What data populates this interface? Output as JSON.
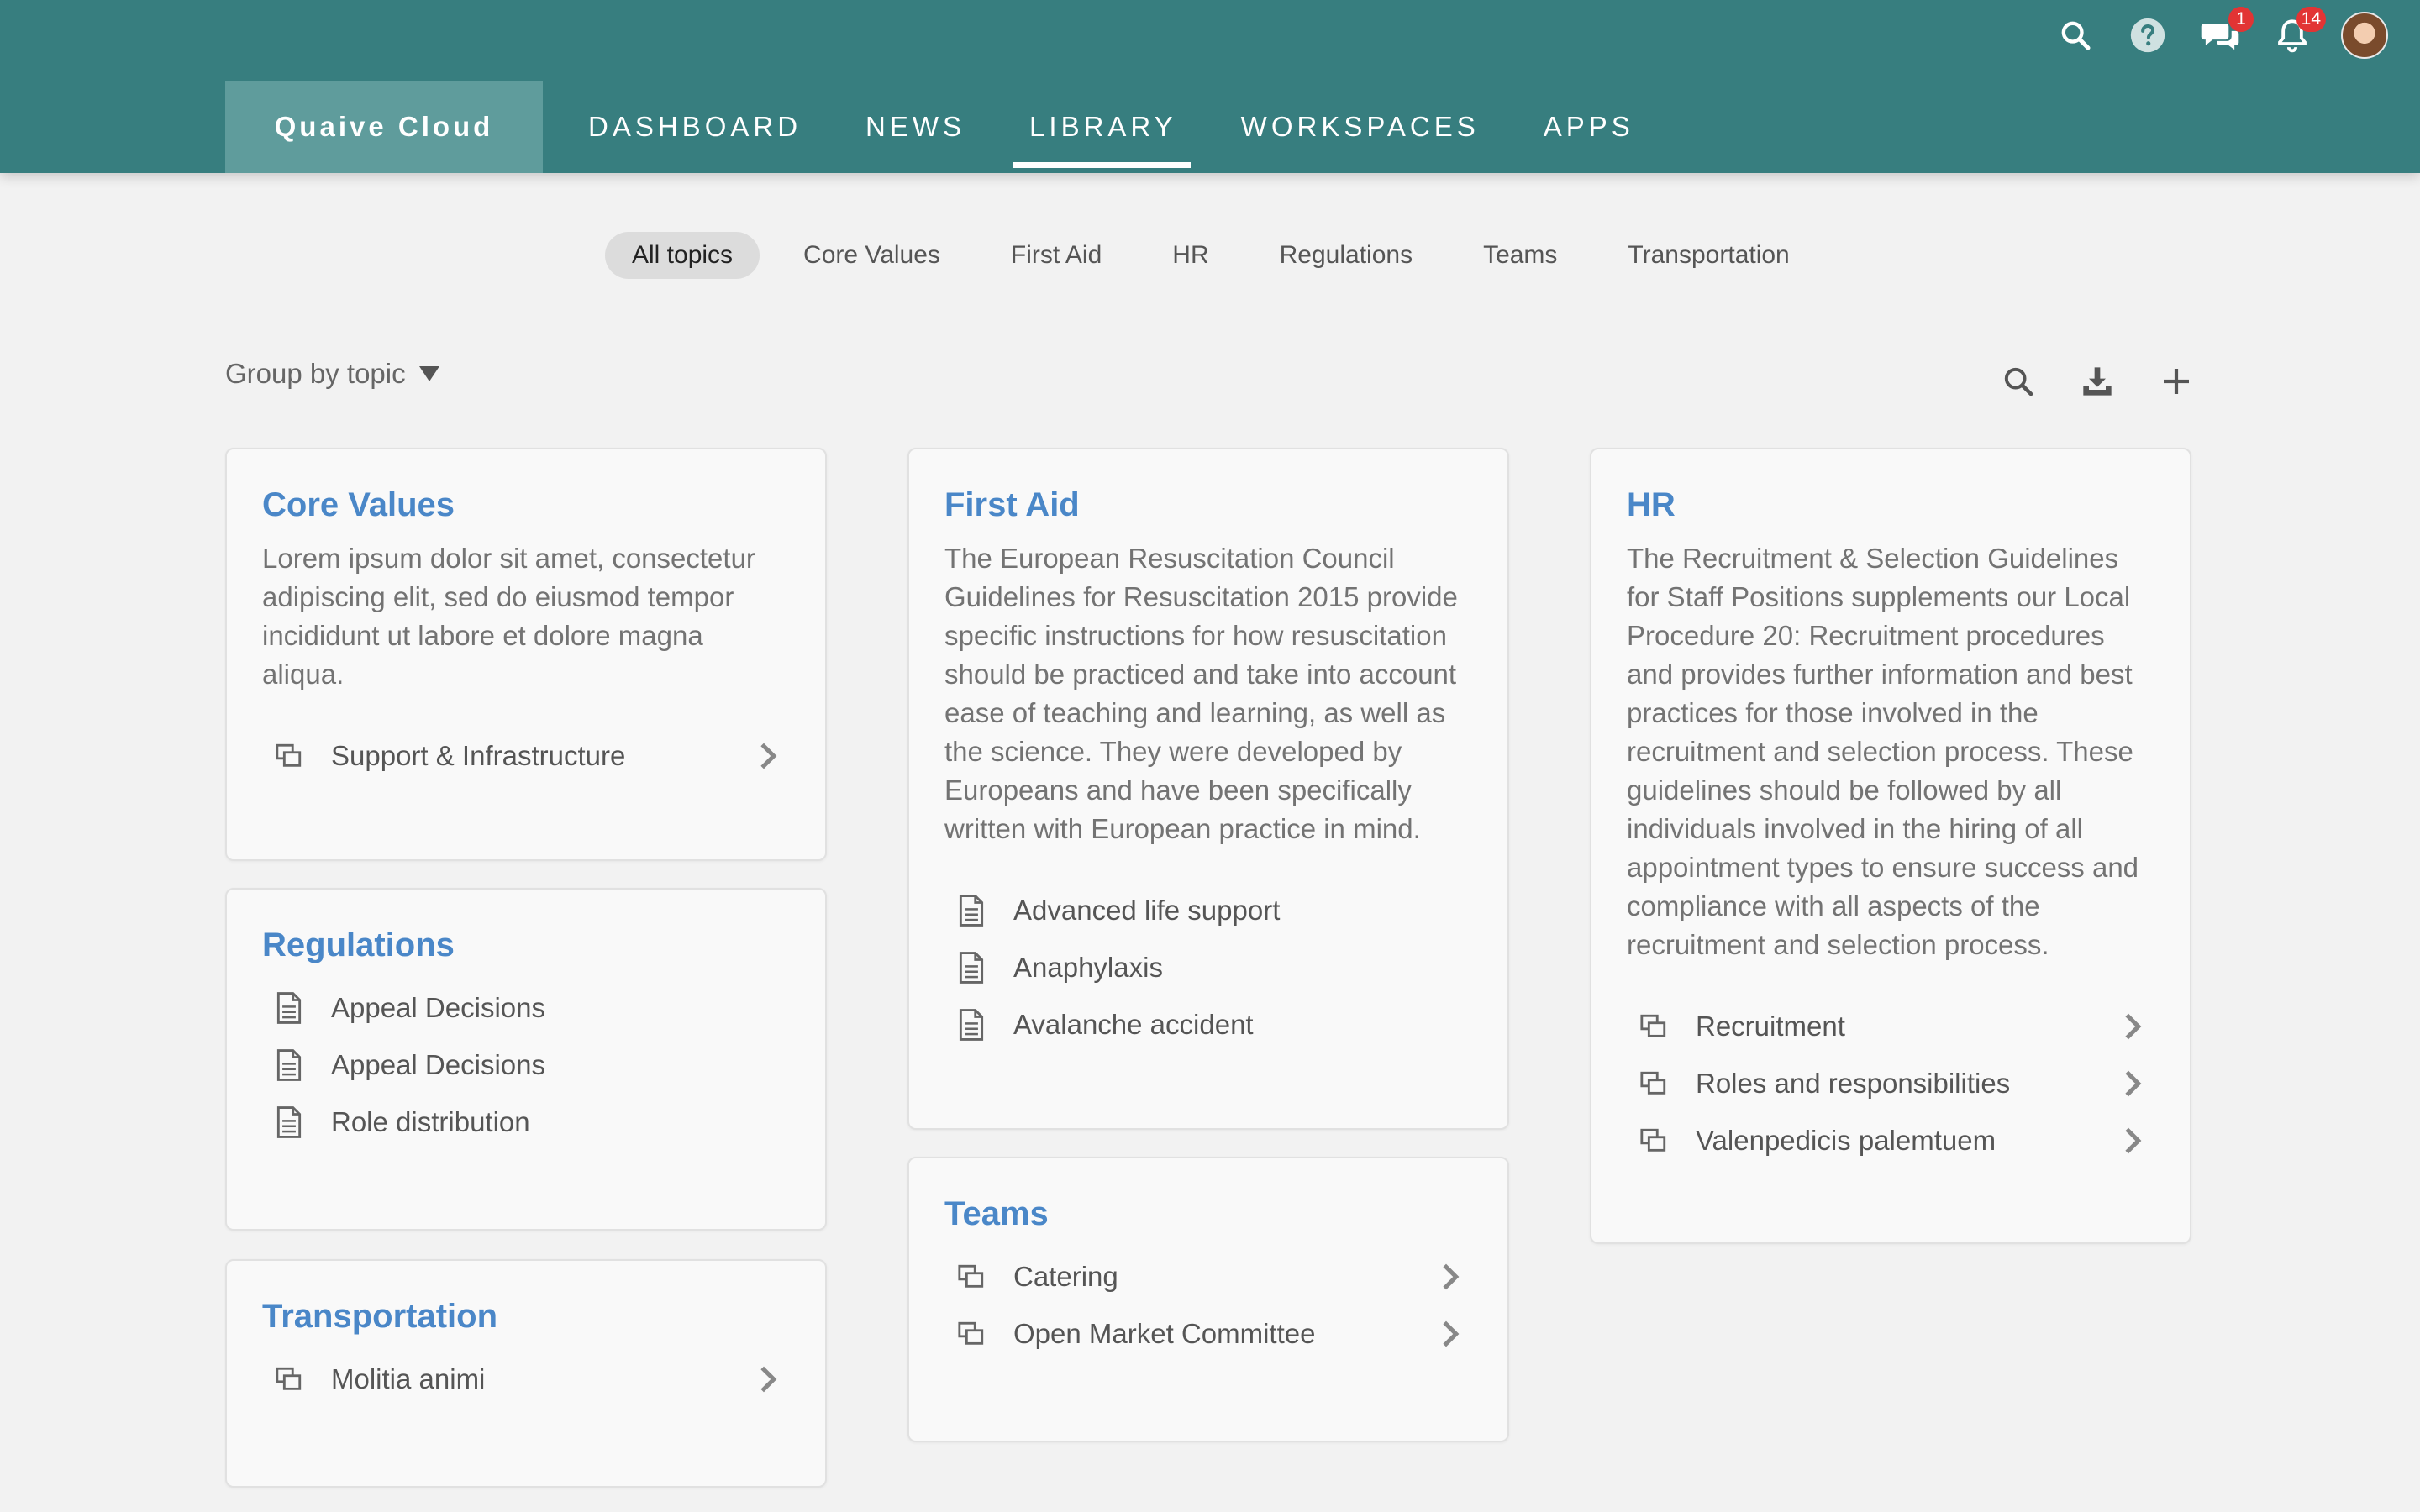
{
  "brand": "Quaive Cloud",
  "nav": [
    {
      "label": "DASHBOARD"
    },
    {
      "label": "NEWS"
    },
    {
      "label": "LIBRARY"
    },
    {
      "label": "WORKSPACES"
    },
    {
      "label": "APPS"
    }
  ],
  "nav_active": "LIBRARY",
  "notifications": {
    "messages": "1",
    "alerts": "14"
  },
  "topics": [
    {
      "label": "All topics"
    },
    {
      "label": "Core Values"
    },
    {
      "label": "First Aid"
    },
    {
      "label": "HR"
    },
    {
      "label": "Regulations"
    },
    {
      "label": "Teams"
    },
    {
      "label": "Transportation"
    }
  ],
  "group_by_label": "Group by topic",
  "cards": {
    "core_values": {
      "title": "Core Values",
      "description": "Lorem ipsum dolor sit amet, consectetur adipiscing elit, sed do eiusmod tempor incididunt ut labore et dolore magna aliqua.",
      "items": [
        {
          "label": "Support & Infrastructure",
          "type": "folder"
        }
      ]
    },
    "regulations": {
      "title": "Regulations",
      "items": [
        {
          "label": "Appeal Decisions",
          "type": "document"
        },
        {
          "label": "Appeal Decisions",
          "type": "document"
        },
        {
          "label": "Role distribution",
          "type": "document"
        }
      ]
    },
    "transportation": {
      "title": "Transportation",
      "items": [
        {
          "label": "Molitia animi",
          "type": "folder"
        }
      ]
    },
    "first_aid": {
      "title": "First Aid",
      "description": "The European Resuscitation Council Guidelines for Resuscitation 2015 provide specific instructions for how resuscitation should be practiced and take into account ease of teaching and learning, as well as the science. They were developed by Europeans and have been specifically written with European practice in mind.",
      "items": [
        {
          "label": "Advanced life support",
          "type": "document"
        },
        {
          "label": "Anaphylaxis",
          "type": "document"
        },
        {
          "label": "Avalanche accident",
          "type": "document"
        }
      ]
    },
    "teams": {
      "title": "Teams",
      "items": [
        {
          "label": "Catering",
          "type": "folder"
        },
        {
          "label": "Open Market Committee",
          "type": "folder"
        }
      ]
    },
    "hr": {
      "title": "HR",
      "description": "The Recruitment & Selection Guidelines for Staff Positions supplements our Local Procedure 20: Recruitment procedures and provides further information and best practices for those involved in the recruitment and selection process. These guidelines should be followed by all individuals involved in the hiring of all appointment types to ensure success and compliance with all aspects of the recruitment and selection process.",
      "items": [
        {
          "label": "Recruitment",
          "type": "folder"
        },
        {
          "label": "Roles and responsibilities",
          "type": "folder"
        },
        {
          "label": "Valenpedicis palemtuem",
          "type": "folder"
        }
      ]
    }
  },
  "colors": {
    "topbar": "#377e7f",
    "brand_bg": "#5f9c9c",
    "card_title": "#4a87c8",
    "badge": "#e23434",
    "page_bg": "#f2f2f2"
  },
  "icons": [
    "search-icon",
    "help-icon",
    "chat-icon",
    "bell-icon",
    "avatar",
    "download-icon",
    "plus-icon",
    "folder-icon",
    "document-icon",
    "chevron-right-icon",
    "caret-down-icon"
  ]
}
